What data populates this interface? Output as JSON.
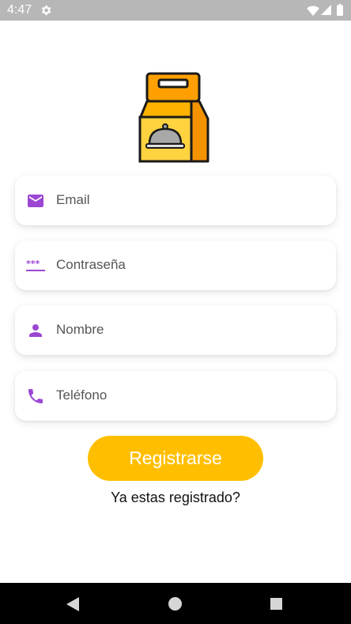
{
  "status_bar": {
    "time": "4:47"
  },
  "form": {
    "email_placeholder": "Email",
    "password_placeholder": "Contraseña",
    "password_icon_text": "***",
    "name_placeholder": "Nombre",
    "phone_placeholder": "Teléfono"
  },
  "actions": {
    "register_label": "Registrarse",
    "login_link": "Ya estas registrado?"
  },
  "colors": {
    "accent_icon": "#9c47d4",
    "button": "#ffbf00",
    "status_bar": "#b7b7b7"
  },
  "icons": [
    "settings-icon",
    "wifi-icon",
    "signal-icon",
    "battery-icon",
    "food-bag-logo",
    "email-icon",
    "password-icon",
    "person-icon",
    "phone-icon",
    "back-icon",
    "home-icon",
    "recents-icon"
  ]
}
